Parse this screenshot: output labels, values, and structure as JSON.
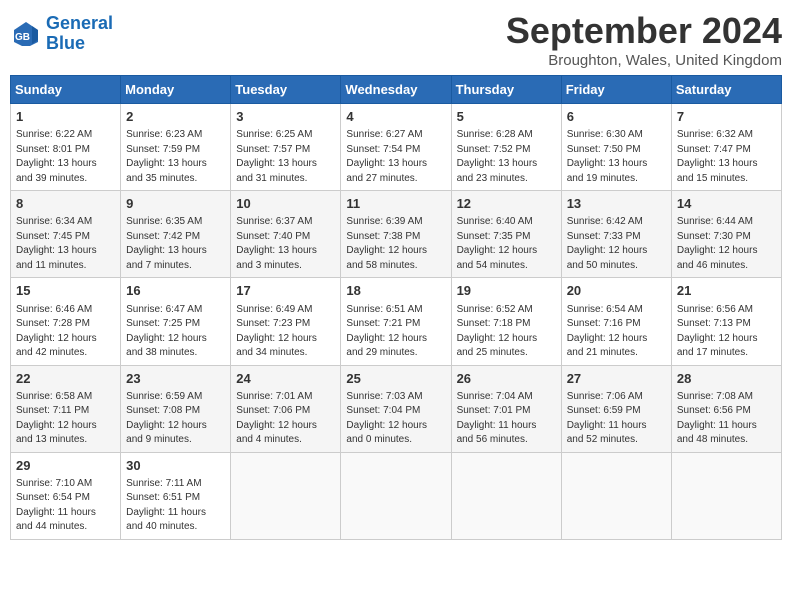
{
  "header": {
    "logo_line1": "General",
    "logo_line2": "Blue",
    "month": "September 2024",
    "location": "Broughton, Wales, United Kingdom"
  },
  "weekdays": [
    "Sunday",
    "Monday",
    "Tuesday",
    "Wednesday",
    "Thursday",
    "Friday",
    "Saturday"
  ],
  "weeks": [
    [
      {
        "day": "1",
        "info": "Sunrise: 6:22 AM\nSunset: 8:01 PM\nDaylight: 13 hours\nand 39 minutes."
      },
      {
        "day": "2",
        "info": "Sunrise: 6:23 AM\nSunset: 7:59 PM\nDaylight: 13 hours\nand 35 minutes."
      },
      {
        "day": "3",
        "info": "Sunrise: 6:25 AM\nSunset: 7:57 PM\nDaylight: 13 hours\nand 31 minutes."
      },
      {
        "day": "4",
        "info": "Sunrise: 6:27 AM\nSunset: 7:54 PM\nDaylight: 13 hours\nand 27 minutes."
      },
      {
        "day": "5",
        "info": "Sunrise: 6:28 AM\nSunset: 7:52 PM\nDaylight: 13 hours\nand 23 minutes."
      },
      {
        "day": "6",
        "info": "Sunrise: 6:30 AM\nSunset: 7:50 PM\nDaylight: 13 hours\nand 19 minutes."
      },
      {
        "day": "7",
        "info": "Sunrise: 6:32 AM\nSunset: 7:47 PM\nDaylight: 13 hours\nand 15 minutes."
      }
    ],
    [
      {
        "day": "8",
        "info": "Sunrise: 6:34 AM\nSunset: 7:45 PM\nDaylight: 13 hours\nand 11 minutes."
      },
      {
        "day": "9",
        "info": "Sunrise: 6:35 AM\nSunset: 7:42 PM\nDaylight: 13 hours\nand 7 minutes."
      },
      {
        "day": "10",
        "info": "Sunrise: 6:37 AM\nSunset: 7:40 PM\nDaylight: 13 hours\nand 3 minutes."
      },
      {
        "day": "11",
        "info": "Sunrise: 6:39 AM\nSunset: 7:38 PM\nDaylight: 12 hours\nand 58 minutes."
      },
      {
        "day": "12",
        "info": "Sunrise: 6:40 AM\nSunset: 7:35 PM\nDaylight: 12 hours\nand 54 minutes."
      },
      {
        "day": "13",
        "info": "Sunrise: 6:42 AM\nSunset: 7:33 PM\nDaylight: 12 hours\nand 50 minutes."
      },
      {
        "day": "14",
        "info": "Sunrise: 6:44 AM\nSunset: 7:30 PM\nDaylight: 12 hours\nand 46 minutes."
      }
    ],
    [
      {
        "day": "15",
        "info": "Sunrise: 6:46 AM\nSunset: 7:28 PM\nDaylight: 12 hours\nand 42 minutes."
      },
      {
        "day": "16",
        "info": "Sunrise: 6:47 AM\nSunset: 7:25 PM\nDaylight: 12 hours\nand 38 minutes."
      },
      {
        "day": "17",
        "info": "Sunrise: 6:49 AM\nSunset: 7:23 PM\nDaylight: 12 hours\nand 34 minutes."
      },
      {
        "day": "18",
        "info": "Sunrise: 6:51 AM\nSunset: 7:21 PM\nDaylight: 12 hours\nand 29 minutes."
      },
      {
        "day": "19",
        "info": "Sunrise: 6:52 AM\nSunset: 7:18 PM\nDaylight: 12 hours\nand 25 minutes."
      },
      {
        "day": "20",
        "info": "Sunrise: 6:54 AM\nSunset: 7:16 PM\nDaylight: 12 hours\nand 21 minutes."
      },
      {
        "day": "21",
        "info": "Sunrise: 6:56 AM\nSunset: 7:13 PM\nDaylight: 12 hours\nand 17 minutes."
      }
    ],
    [
      {
        "day": "22",
        "info": "Sunrise: 6:58 AM\nSunset: 7:11 PM\nDaylight: 12 hours\nand 13 minutes."
      },
      {
        "day": "23",
        "info": "Sunrise: 6:59 AM\nSunset: 7:08 PM\nDaylight: 12 hours\nand 9 minutes."
      },
      {
        "day": "24",
        "info": "Sunrise: 7:01 AM\nSunset: 7:06 PM\nDaylight: 12 hours\nand 4 minutes."
      },
      {
        "day": "25",
        "info": "Sunrise: 7:03 AM\nSunset: 7:04 PM\nDaylight: 12 hours\nand 0 minutes."
      },
      {
        "day": "26",
        "info": "Sunrise: 7:04 AM\nSunset: 7:01 PM\nDaylight: 11 hours\nand 56 minutes."
      },
      {
        "day": "27",
        "info": "Sunrise: 7:06 AM\nSunset: 6:59 PM\nDaylight: 11 hours\nand 52 minutes."
      },
      {
        "day": "28",
        "info": "Sunrise: 7:08 AM\nSunset: 6:56 PM\nDaylight: 11 hours\nand 48 minutes."
      }
    ],
    [
      {
        "day": "29",
        "info": "Sunrise: 7:10 AM\nSunset: 6:54 PM\nDaylight: 11 hours\nand 44 minutes."
      },
      {
        "day": "30",
        "info": "Sunrise: 7:11 AM\nSunset: 6:51 PM\nDaylight: 11 hours\nand 40 minutes."
      },
      {
        "day": "",
        "info": ""
      },
      {
        "day": "",
        "info": ""
      },
      {
        "day": "",
        "info": ""
      },
      {
        "day": "",
        "info": ""
      },
      {
        "day": "",
        "info": ""
      }
    ]
  ]
}
